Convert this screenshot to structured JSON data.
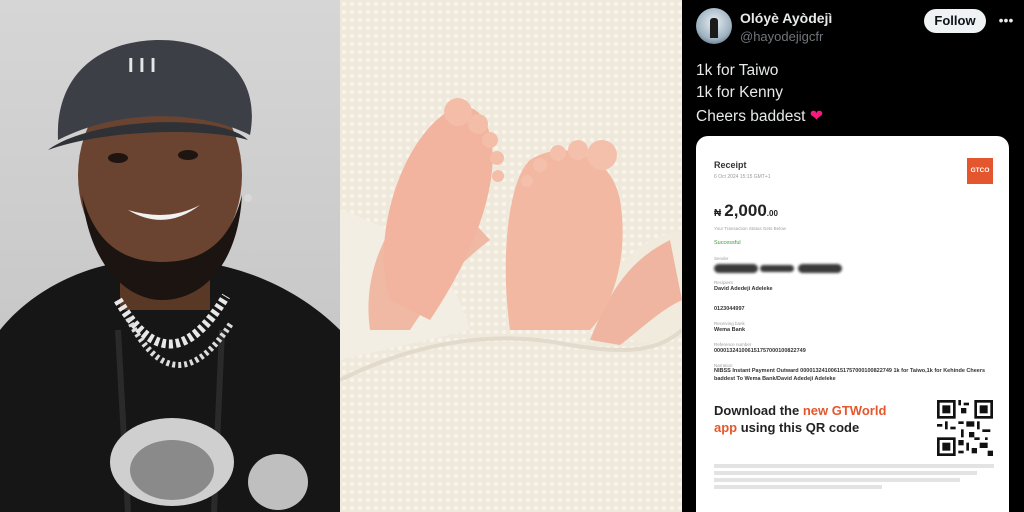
{
  "tweet": {
    "display_name": "Olóyè Ayòdejì",
    "handle": "@hayodejigcfr",
    "follow_label": "Follow",
    "more_icon": "more-icon",
    "lines": [
      "1k for Taiwo",
      "1k for Kenny",
      "Cheers baddest"
    ],
    "emoji": "❤"
  },
  "receipt": {
    "title": "Receipt",
    "date": "6 Oct 2024 15:15 GMT+1",
    "logo_text": "GTCO",
    "currency": "₦",
    "amount": "2,000",
    "amount_decimal": ".00",
    "amount_caption": "Your Transaction Status Gets Below",
    "status": "Successful",
    "fields": [
      {
        "label": "Sender",
        "value": ""
      },
      {
        "label": "Recipient",
        "value": "David Adedeji Adeleke"
      },
      {
        "label": "",
        "value": "0123044997"
      },
      {
        "label": "Receiving bank",
        "value": "Wema Bank"
      },
      {
        "label": "Reference number",
        "value": "000013241006151757000100822749"
      },
      {
        "label": "Narration",
        "value": "NIBSS Instant Payment Outward 000013241006151757000100822749 1k for Taiwo,1k for Kehinde Cheers baddest To Wema Bank/David Adedeji Adeleke"
      }
    ],
    "cta_prefix": "Download the ",
    "cta_highlight": "new GTWorld app",
    "cta_suffix": " using this QR code"
  },
  "colors": {
    "accent": "#e4572e",
    "success": "#3a9a3a",
    "heart": "#f91880"
  }
}
